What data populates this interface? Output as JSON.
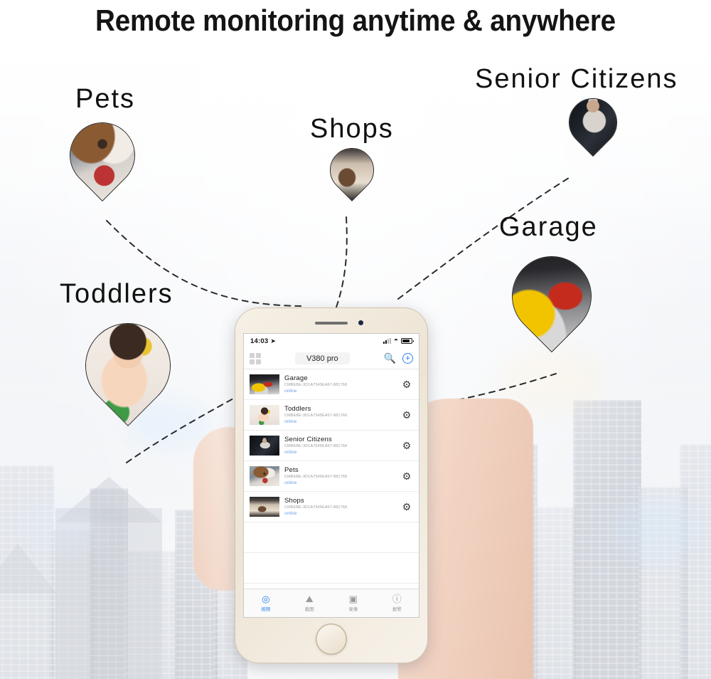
{
  "headline": "Remote monitoring anytime & anywhere",
  "scene": {
    "pins": [
      {
        "id": "pets",
        "label": "Pets",
        "photo_class": "ph-dog"
      },
      {
        "id": "shops",
        "label": "Shops",
        "photo_class": "ph-bag"
      },
      {
        "id": "seniors",
        "label": "Senior Citizens",
        "photo_class": "ph-old"
      },
      {
        "id": "garage",
        "label": "Garage",
        "photo_class": "ph-car"
      },
      {
        "id": "toddlers",
        "label": "Toddlers",
        "photo_class": "ph-baby"
      }
    ]
  },
  "phone": {
    "status_bar": {
      "time": "14:03",
      "location_icon": "location-arrow-icon",
      "signal_icon": "signal-bars-icon",
      "wifi_icon": "wifi-icon",
      "battery_icon": "battery-icon"
    },
    "nav_bar": {
      "grid_icon": "grid-menu-icon",
      "title": "V380 pro",
      "search_icon": "search-icon",
      "search_glyph": "⚲",
      "add_icon": "add-device-icon",
      "add_glyph": "+"
    },
    "devices": [
      {
        "name": "Garage",
        "id": "CMBEBE-3D1A7545EA67-881768",
        "status": "online",
        "thumb_class": "ph-car"
      },
      {
        "name": "Toddlers",
        "id": "CMBEBE-3D1A7545EA67-881768",
        "status": "online",
        "thumb_class": "ph-baby"
      },
      {
        "name": "Senior Citizens",
        "id": "CMBEBE-3D1A7545EA67-881768",
        "status": "online",
        "thumb_class": "ph-old"
      },
      {
        "name": "Pets",
        "id": "CMBEBE-3D1A7545EA67-881768",
        "status": "online",
        "thumb_class": "ph-dog"
      },
      {
        "name": "Shops",
        "id": "CMBEBE-3D1A7545EA67-881768",
        "status": "online",
        "thumb_class": "ph-bag"
      }
    ],
    "device_settings_glyph": "⚙",
    "tabs": [
      {
        "label": "视频",
        "icon": "live-video-icon",
        "glyph": "◎",
        "active": true
      },
      {
        "label": "截图",
        "icon": "screenshot-icon",
        "glyph": "⛰",
        "active": false
      },
      {
        "label": "录像",
        "icon": "recording-icon",
        "glyph": "▣",
        "active": false
      },
      {
        "label": "报警",
        "icon": "alarm-icon",
        "glyph": "!",
        "active": false
      }
    ]
  },
  "colors": {
    "accent_blue": "#2d7ff0",
    "status_blue": "#6ea0e8",
    "headline_black": "#141414",
    "pin_outline": "#222222"
  }
}
